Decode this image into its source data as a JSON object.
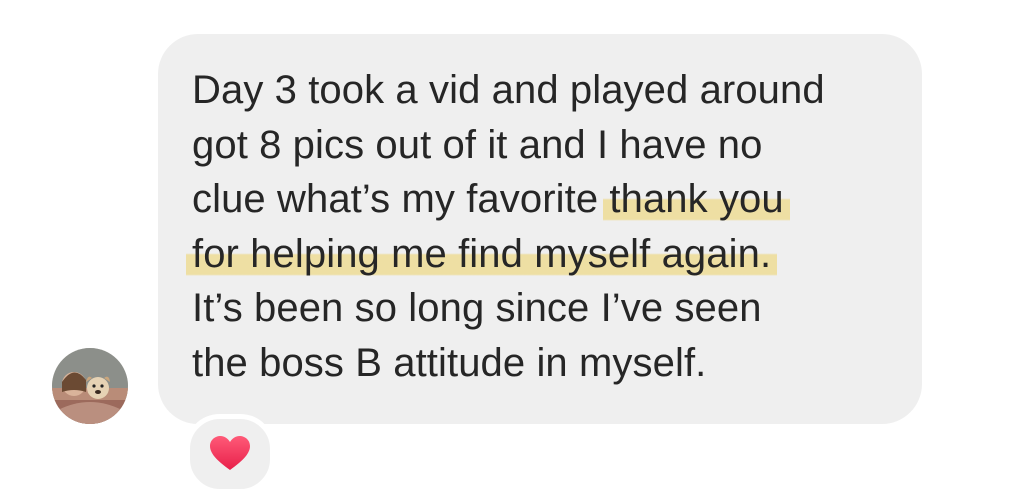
{
  "message": {
    "lines": [
      {
        "before": "Day 3 took a vid and played around",
        "highlight": "",
        "after": ""
      },
      {
        "before": "got 8 pics out of it and I have no",
        "highlight": "",
        "after": ""
      },
      {
        "before": "clue what’s my favorite ",
        "highlight": "thank you",
        "after": ""
      },
      {
        "before": "",
        "highlight": "for helping me find myself again.",
        "after": ""
      },
      {
        "before": "It’s been so long since I’ve seen",
        "highlight": "",
        "after": ""
      },
      {
        "before": "the boss B attitude in myself.",
        "highlight": "",
        "after": ""
      }
    ]
  },
  "reaction": {
    "icon": "heart-icon",
    "color": "#f0335a"
  },
  "avatar": {
    "icon": "profile-photo"
  },
  "colors": {
    "bubble": "#efefef",
    "text": "#262626",
    "highlight": "#eedc96"
  }
}
